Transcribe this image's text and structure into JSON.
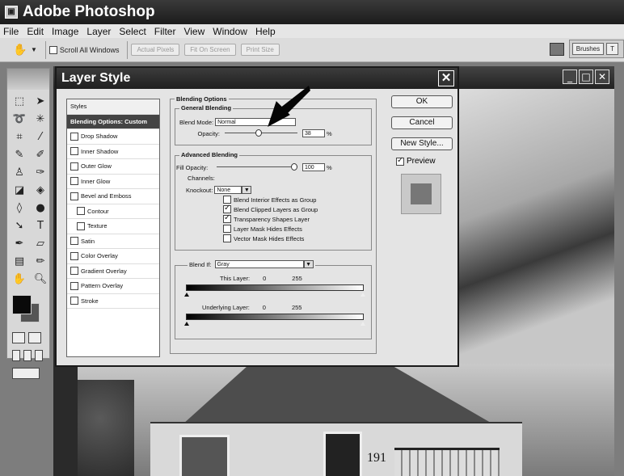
{
  "app": {
    "title": "Adobe Photoshop",
    "menus": [
      "File",
      "Edit",
      "Image",
      "Layer",
      "Select",
      "Filter",
      "View",
      "Window",
      "Help"
    ]
  },
  "options_bar": {
    "scroll_all_windows": "Scroll All Windows",
    "actual_pixels": "Actual Pixels",
    "fit_on_screen": "Fit On Screen",
    "print_size": "Print Size",
    "palette_tabs": [
      "Brushes",
      "T"
    ]
  },
  "dialog": {
    "title": "Layer Style",
    "styles": [
      {
        "label": "Styles",
        "kind": "header"
      },
      {
        "label": "Blending Options: Custom",
        "kind": "selected"
      },
      {
        "label": "Drop Shadow",
        "kind": "check"
      },
      {
        "label": "Inner Shadow",
        "kind": "check"
      },
      {
        "label": "Outer Glow",
        "kind": "check"
      },
      {
        "label": "Inner Glow",
        "kind": "check"
      },
      {
        "label": "Bevel and Emboss",
        "kind": "check"
      },
      {
        "label": "Contour",
        "kind": "sub"
      },
      {
        "label": "Texture",
        "kind": "sub"
      },
      {
        "label": "Satin",
        "kind": "check"
      },
      {
        "label": "Color Overlay",
        "kind": "check"
      },
      {
        "label": "Gradient Overlay",
        "kind": "check"
      },
      {
        "label": "Pattern Overlay",
        "kind": "check"
      },
      {
        "label": "Stroke",
        "kind": "check"
      }
    ],
    "blending_options_label": "Blending Options",
    "general_blending": {
      "label": "General Blending",
      "blend_mode_label": "Blend Mode:",
      "blend_mode_value": "Normal",
      "opacity_label": "Opacity:",
      "opacity_value": "38",
      "opacity_level": 0.38,
      "percent": "%"
    },
    "advanced_blending": {
      "label": "Advanced Blending",
      "fill_opacity_label": "Fill Opacity:",
      "fill_opacity_value": "100",
      "fill_opacity_level": 1.0,
      "percent": "%",
      "channels_label": "Channels:",
      "knockout_label": "Knockout:",
      "knockout_value": "None",
      "options": [
        {
          "label": "Blend Interior Effects as Group",
          "checked": false
        },
        {
          "label": "Blend Clipped Layers as Group",
          "checked": true
        },
        {
          "label": "Transparency Shapes Layer",
          "checked": true
        },
        {
          "label": "Layer Mask Hides Effects",
          "checked": false
        },
        {
          "label": "Vector Mask Hides Effects",
          "checked": false
        }
      ]
    },
    "blend_if": {
      "label": "Blend If:",
      "value": "Gray",
      "this_layer_label": "This Layer:",
      "this_layer_low": "0",
      "this_layer_high": "255",
      "underlying_label": "Underlying Layer:",
      "underlying_low": "0",
      "underlying_high": "255"
    },
    "buttons": {
      "ok": "OK",
      "cancel": "Cancel",
      "new_style": "New Style...",
      "preview": "Preview"
    },
    "preview_checked": true
  },
  "document": {
    "house_number": "191"
  }
}
